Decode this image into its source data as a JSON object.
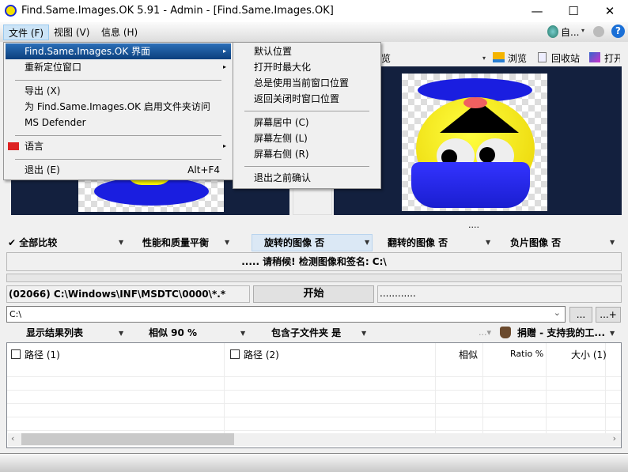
{
  "window": {
    "title": "Find.Same.Images.OK 5.91 - Admin - [Find.Same.Images.OK]",
    "minimize": "—",
    "maximize": "☐",
    "close": "✕"
  },
  "menubar": {
    "items": [
      {
        "label": "文件 (F)"
      },
      {
        "label": "视图 (V)"
      },
      {
        "label": "信息 (H)"
      }
    ],
    "lang_label": "自...",
    "lang_arrow": "▾",
    "help": "?"
  },
  "file_menu": {
    "items": [
      {
        "label": "Find.Same.Images.OK 界面",
        "arrow": "▸"
      },
      {
        "label": "重新定位窗口",
        "arrow": "▸"
      },
      {
        "label": "导出 (X)"
      },
      {
        "label": "为 Find.Same.Images.OK 启用文件夹访问"
      },
      {
        "label": "MS Defender"
      },
      {
        "label": "语言",
        "arrow": "▸"
      },
      {
        "label": "退出 (E)",
        "shortcut": "Alt+F4"
      }
    ]
  },
  "sub_menu": {
    "items": [
      {
        "label": "默认位置"
      },
      {
        "label": "打开时最大化"
      },
      {
        "label": "总是使用当前窗口位置"
      },
      {
        "label": "返回关闭时窗口位置"
      },
      {
        "label": "屏幕居中 (C)"
      },
      {
        "label": "屏幕左侧 (L)"
      },
      {
        "label": "屏幕右侧 (R)"
      },
      {
        "label": "退出之前确认"
      }
    ]
  },
  "preview_toolbar": {
    "partial_label": "览",
    "browse": "浏览",
    "recycle": "回收站",
    "open": "打开",
    "arrow": "▾"
  },
  "preview": {
    "dots": "...."
  },
  "options": [
    {
      "label": "✔ 全部比较"
    },
    {
      "label": "性能和质量平衡"
    },
    {
      "label": "旋转的图像 否"
    },
    {
      "label": "翻转的图像 否"
    },
    {
      "label": "负片图像 否"
    }
  ],
  "status": {
    "message": "..... 请稍候!  检测图像和签名: C:\\",
    "progress": 0
  },
  "scan": {
    "current_file": "(02066) C:\\Windows\\INF\\MSDTC\\0000\\*.*",
    "start_button": "开始",
    "info": "............"
  },
  "path": {
    "value": "C:\\",
    "browse": "...",
    "add": "...+"
  },
  "options2": [
    {
      "label": "显示结果列表"
    },
    {
      "label": "相似 90 %"
    },
    {
      "label": "包含子文件夹 是"
    }
  ],
  "donate": {
    "more": "...▾",
    "label": "捐赠 - 支持我的工..."
  },
  "table": {
    "columns": [
      "路径 (1)",
      "路径 (2)",
      "相似",
      "Ratio %",
      "大小 (1)"
    ],
    "rows": []
  },
  "colors": {
    "accent": "#0b3f7d",
    "panel": "#13203e"
  }
}
